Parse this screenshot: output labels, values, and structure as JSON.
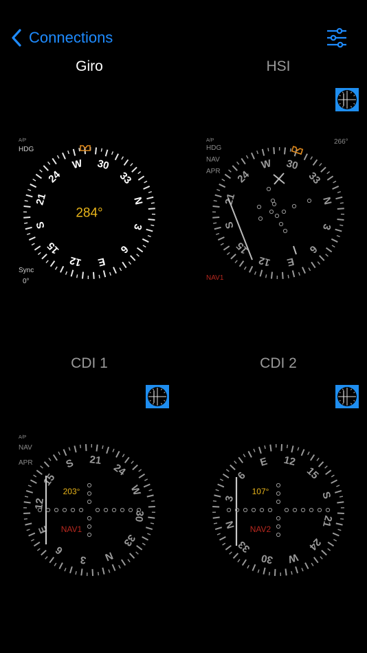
{
  "nav": {
    "back_label": "Connections"
  },
  "panels": {
    "giro": {
      "title": "Giro",
      "ap_label": "A/P",
      "mode_labels": [
        "HDG"
      ],
      "heading": 284,
      "readout": "284°",
      "sync_label": "Sync",
      "sync_value": "0°"
    },
    "hsi": {
      "title": "HSI",
      "ap_label": "A/P",
      "mode_labels": [
        "HDG",
        "NAV",
        "APR"
      ],
      "heading": 284,
      "bug_readout": "266°",
      "source_label": "NAV1"
    },
    "cdi1": {
      "title": "CDI 1",
      "ap_label": "A/P",
      "mode_labels": [
        "NAV",
        "APR"
      ],
      "obs": 203,
      "readout": "203°",
      "source_label": "NAV1"
    },
    "cdi2": {
      "title": "CDI 2",
      "obs": 107,
      "readout": "107°",
      "source_label": "NAV2"
    }
  },
  "colors": {
    "accent": "#1e8bff",
    "readout": "#e8b41a",
    "bug": "#e08a1e",
    "nav_source": "#b8281f",
    "toggle_bg": "#1f8ef0"
  },
  "icons": {
    "back": "chevron-left-icon",
    "settings": "sliders-icon",
    "toggle": "instrument-toggle-icon"
  }
}
